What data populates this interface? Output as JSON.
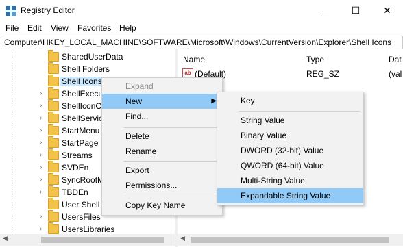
{
  "window": {
    "title": "Registry Editor",
    "minimize_glyph": "—",
    "maximize_glyph": "☐",
    "close_glyph": "✕"
  },
  "menubar": {
    "file": "File",
    "edit": "Edit",
    "view": "View",
    "favorites": "Favorites",
    "help": "Help"
  },
  "address": {
    "path": "Computer\\HKEY_LOCAL_MACHINE\\SOFTWARE\\Microsoft\\Windows\\CurrentVersion\\Explorer\\Shell Icons"
  },
  "tree": {
    "items": [
      {
        "label": "SharedUserData"
      },
      {
        "label": "Shell Folders"
      },
      {
        "label": "Shell Icons"
      },
      {
        "label": "ShellExecut"
      },
      {
        "label": "ShellIconO"
      },
      {
        "label": "ShellServic"
      },
      {
        "label": "StartMenu"
      },
      {
        "label": "StartPage"
      },
      {
        "label": "Streams"
      },
      {
        "label": "SVDEn"
      },
      {
        "label": "SyncRootM"
      },
      {
        "label": "TBDEn"
      },
      {
        "label": "User Shell F"
      },
      {
        "label": "UsersFiles"
      },
      {
        "label": "UsersLibraries"
      }
    ]
  },
  "list": {
    "col_name": "Name",
    "col_type": "Type",
    "col_data": "Dat",
    "rows": [
      {
        "name": "(Default)",
        "type": "REG_SZ",
        "data": "(val"
      }
    ]
  },
  "context_menu": {
    "expand": "Expand",
    "new": "New",
    "find": "Find...",
    "delete": "Delete",
    "rename": "Rename",
    "export": "Export",
    "permissions": "Permissions...",
    "copy_key_name": "Copy Key Name"
  },
  "new_submenu": {
    "key": "Key",
    "string_value": "String Value",
    "binary_value": "Binary Value",
    "dword_value": "DWORD (32-bit) Value",
    "qword_value": "QWORD (64-bit) Value",
    "multi_string_value": "Multi-String Value",
    "expandable_string_value": "Expandable String Value"
  },
  "colors": {
    "menu_hover": "#91c9f7",
    "tree_selected": "#cce8ff",
    "folder": "#f3c24a"
  }
}
